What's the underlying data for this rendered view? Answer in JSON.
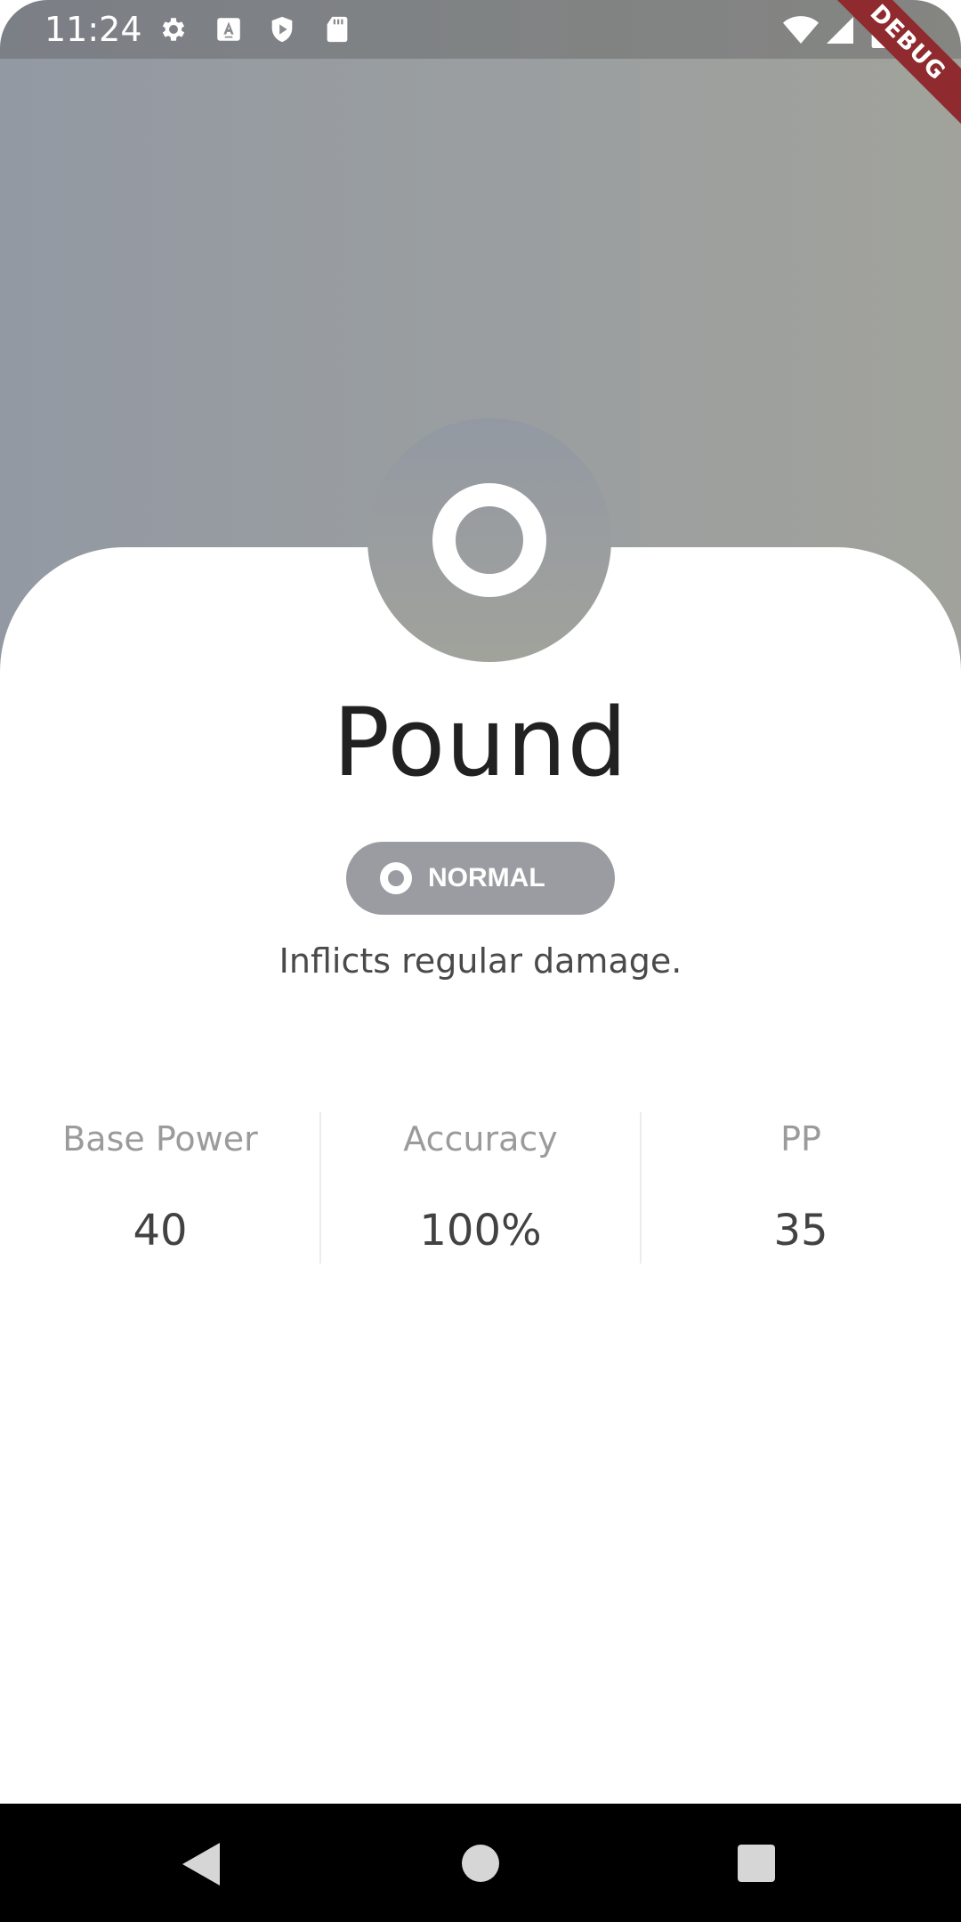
{
  "status_bar": {
    "time": "11:24",
    "left_icons": [
      "gear-icon",
      "text-a-icon",
      "shield-play-icon",
      "sd-card-icon"
    ],
    "right_icons": [
      "wifi-icon",
      "signal-icon",
      "battery-icon"
    ]
  },
  "debug_banner": {
    "label": "DEBUG"
  },
  "move": {
    "name": "Pound",
    "type_label": "NORMAL",
    "type_icon": "normal-type-icon",
    "description": "Inflicts regular damage.",
    "colors": {
      "gradient_start": "#9399a3",
      "gradient_end": "#a1a29c",
      "pill": "#9a9ca2"
    }
  },
  "stats": [
    {
      "label": "Base Power",
      "value": "40"
    },
    {
      "label": "Accuracy",
      "value": "100%"
    },
    {
      "label": "PP",
      "value": "35"
    }
  ],
  "nav_bar": {
    "buttons": [
      "back-icon",
      "home-icon",
      "recents-icon"
    ]
  }
}
